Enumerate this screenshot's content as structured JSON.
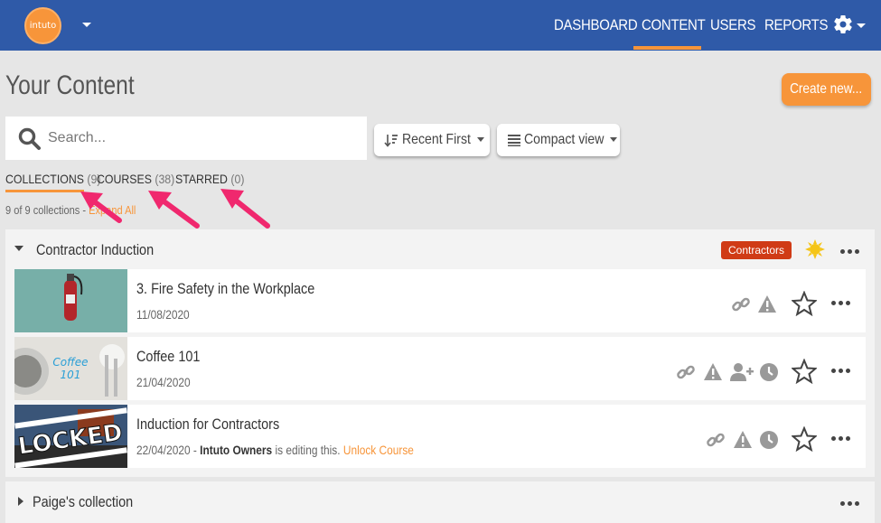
{
  "nav": {
    "logo_text": "intuto",
    "items": [
      "DASHBOARD",
      "CONTENT",
      "USERS",
      "REPORTS"
    ],
    "active": "CONTENT",
    "accent": "#f7953a",
    "bar_color": "#2f5aa8"
  },
  "header": {
    "title": "Your Content",
    "create_label": "Create new..."
  },
  "search": {
    "placeholder": "Search..."
  },
  "sort": {
    "label": "Recent First"
  },
  "view": {
    "label": "Compact view"
  },
  "tabs": [
    {
      "label": "COLLECTIONS",
      "count": "(9)"
    },
    {
      "label": "COURSES",
      "count": "(38)"
    },
    {
      "label": "STARRED",
      "count": "(0)"
    }
  ],
  "summary": {
    "text": "9 of 9 collections - ",
    "link": "Expand All"
  },
  "collections": [
    {
      "title": "Contractor Induction",
      "tag": "Contractors",
      "tag_color": "#d03b16",
      "courses": [
        {
          "title": "3. Fire Safety in the Workplace",
          "date": "11/08/2020",
          "thumb_text": "",
          "icons": [
            "link-icon",
            "warning-icon"
          ]
        },
        {
          "title": "Coffee 101",
          "date": "21/04/2020",
          "thumb_text": "Coffee 101",
          "icons": [
            "link-icon",
            "warning-icon",
            "user-plus-icon",
            "clock-icon"
          ]
        },
        {
          "title": "Induction for Contractors",
          "date": "22/04/2020",
          "editor": "Intuto Owners",
          "editing_text": "is editing this.",
          "unlock": "Unlock Course",
          "thumb_text": "LOCKED",
          "icons": [
            "link-icon",
            "warning-icon",
            "clock-icon"
          ]
        }
      ]
    },
    {
      "title": "Paige's collection"
    }
  ]
}
